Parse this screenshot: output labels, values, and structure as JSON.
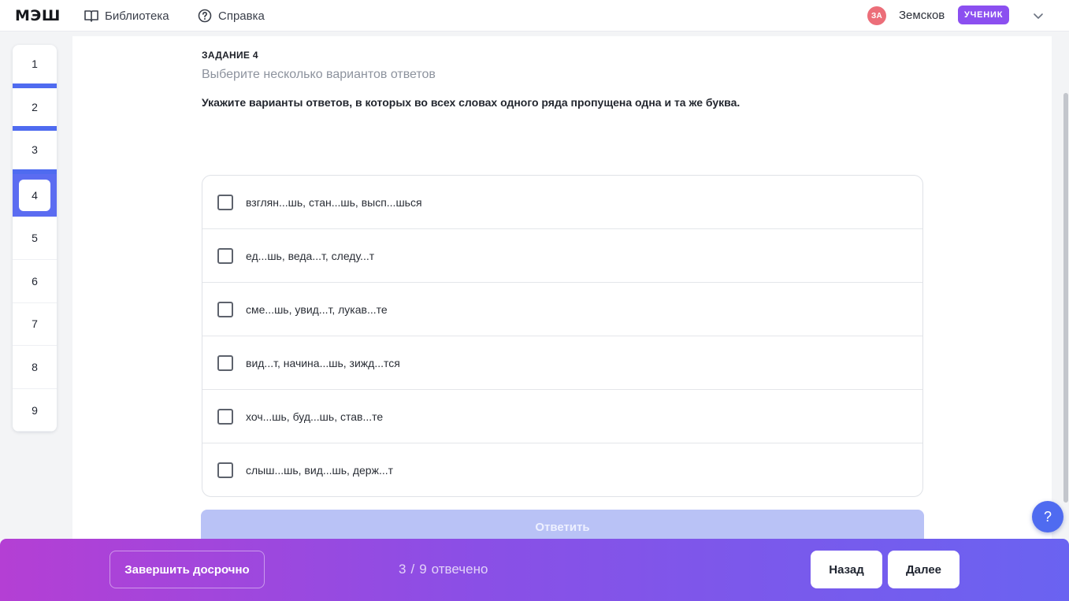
{
  "app": {
    "logo": "МЭШ"
  },
  "topnav": [
    {
      "label": "Библиотека",
      "icon": "book-icon"
    },
    {
      "label": "Справка",
      "icon": "help-circle-icon"
    }
  ],
  "user": {
    "initials": "ЗА",
    "name": "Земсков",
    "role": "УЧЕНИК"
  },
  "question_nav": {
    "items": [
      {
        "label": "1",
        "state": "answered"
      },
      {
        "label": "2",
        "state": "answered"
      },
      {
        "label": "3",
        "state": "answered"
      },
      {
        "label": "4",
        "state": "current"
      },
      {
        "label": "5",
        "state": "unanswered"
      },
      {
        "label": "6",
        "state": "unanswered"
      },
      {
        "label": "7",
        "state": "unanswered"
      },
      {
        "label": "8",
        "state": "unanswered"
      },
      {
        "label": "9",
        "state": "unanswered"
      }
    ]
  },
  "task": {
    "label": "ЗАДАНИЕ 4",
    "hint": "Выберите несколько вариантов ответов",
    "question": "Укажите варианты ответов, в которых во всех словах одного ряда пропущена одна и та же буква.",
    "options": [
      {
        "text": "взглян...шь, стан...шь, высп...шься",
        "checked": false
      },
      {
        "text": "ед...шь, веда...т, следу...т",
        "checked": false
      },
      {
        "text": "сме...шь, увид...т, лукав...те",
        "checked": false
      },
      {
        "text": "вид...т, начина...шь, зижд...тся",
        "checked": false
      },
      {
        "text": "хоч...шь, буд...шь, став...те",
        "checked": false
      },
      {
        "text": "слыш...шь, вид...шь, держ...т",
        "checked": false
      }
    ],
    "submit_label": "Ответить"
  },
  "help_fab": "?",
  "footer": {
    "finish_label": "Завершить досрочно",
    "progress": {
      "answered": "3",
      "separator": "/",
      "total": "9",
      "suffix": "отвечено"
    },
    "back_label": "Назад",
    "next_label": "Далее"
  },
  "colors": {
    "accent": "#4f6bf0",
    "role_badge": "#8b4ff0",
    "avatar": "#ec6e79"
  }
}
